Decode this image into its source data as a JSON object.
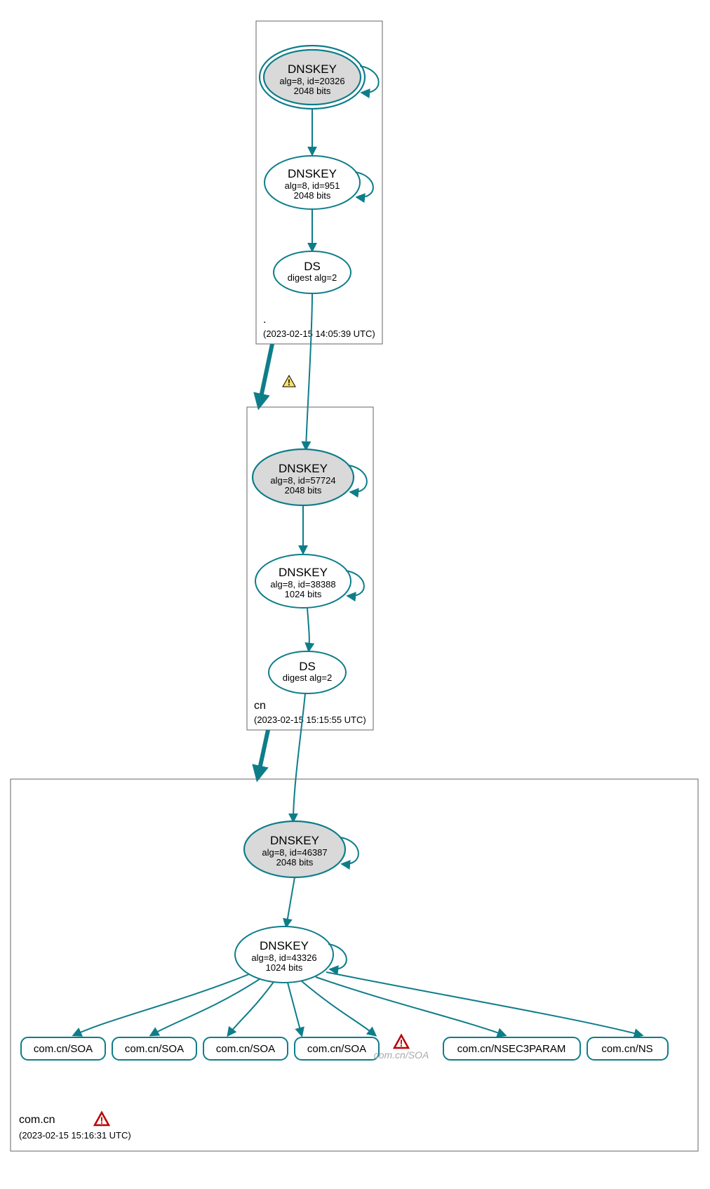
{
  "colors": {
    "stroke": "#0e7d8a",
    "ksk_fill": "#d9d9d9",
    "warn_fill": "#ffe066",
    "error_stroke": "#b00"
  },
  "zones": [
    {
      "id": "root",
      "label": ".",
      "timestamp": "(2023-02-15 14:05:39 UTC)",
      "nodes": [
        {
          "id": "root-ksk",
          "type": "dnskey-ksk-trust",
          "title": "DNSKEY",
          "sub1": "alg=8, id=20326",
          "sub2": "2048 bits"
        },
        {
          "id": "root-zsk",
          "type": "dnskey-zsk",
          "title": "DNSKEY",
          "sub1": "alg=8, id=951",
          "sub2": "2048 bits"
        },
        {
          "id": "root-ds",
          "type": "ds",
          "title": "DS",
          "sub1": "digest alg=2"
        }
      ]
    },
    {
      "id": "cn",
      "label": "cn",
      "timestamp": "(2023-02-15 15:15:55 UTC)",
      "nodes": [
        {
          "id": "cn-ksk",
          "type": "dnskey-ksk",
          "title": "DNSKEY",
          "sub1": "alg=8, id=57724",
          "sub2": "2048 bits"
        },
        {
          "id": "cn-zsk",
          "type": "dnskey-zsk",
          "title": "DNSKEY",
          "sub1": "alg=8, id=38388",
          "sub2": "1024 bits"
        },
        {
          "id": "cn-ds",
          "type": "ds",
          "title": "DS",
          "sub1": "digest alg=2"
        }
      ]
    },
    {
      "id": "comcn",
      "label": "com.cn",
      "timestamp": "(2023-02-15 15:16:31 UTC)",
      "status": "error",
      "nodes": [
        {
          "id": "comcn-ksk",
          "type": "dnskey-ksk",
          "title": "DNSKEY",
          "sub1": "alg=8, id=46387",
          "sub2": "2048 bits"
        },
        {
          "id": "comcn-zsk",
          "type": "dnskey-zsk",
          "title": "DNSKEY",
          "sub1": "alg=8, id=43326",
          "sub2": "1024 bits"
        },
        {
          "id": "rr1",
          "type": "record",
          "label": "com.cn/SOA"
        },
        {
          "id": "rr2",
          "type": "record",
          "label": "com.cn/SOA"
        },
        {
          "id": "rr3",
          "type": "record",
          "label": "com.cn/SOA"
        },
        {
          "id": "rr4",
          "type": "record",
          "label": "com.cn/SOA"
        },
        {
          "id": "rr5",
          "type": "record-faded",
          "label": "com.cn/SOA",
          "status": "error"
        },
        {
          "id": "rr6",
          "type": "record",
          "label": "com.cn/NSEC3PARAM"
        },
        {
          "id": "rr7",
          "type": "record",
          "label": "com.cn/NS"
        }
      ]
    }
  ],
  "edges": [
    {
      "from": "root-ksk",
      "to": "root-ksk",
      "kind": "self"
    },
    {
      "from": "root-ksk",
      "to": "root-zsk"
    },
    {
      "from": "root-zsk",
      "to": "root-zsk",
      "kind": "self"
    },
    {
      "from": "root-zsk",
      "to": "root-ds"
    },
    {
      "from": "root-ds",
      "to": "cn-ksk"
    },
    {
      "from": "root",
      "to": "cn",
      "kind": "zone",
      "status": "warning"
    },
    {
      "from": "cn-ksk",
      "to": "cn-ksk",
      "kind": "self"
    },
    {
      "from": "cn-ksk",
      "to": "cn-zsk"
    },
    {
      "from": "cn-zsk",
      "to": "cn-zsk",
      "kind": "self"
    },
    {
      "from": "cn-zsk",
      "to": "cn-ds"
    },
    {
      "from": "cn-ds",
      "to": "comcn-ksk"
    },
    {
      "from": "cn",
      "to": "comcn",
      "kind": "zone"
    },
    {
      "from": "comcn-ksk",
      "to": "comcn-ksk",
      "kind": "self"
    },
    {
      "from": "comcn-ksk",
      "to": "comcn-zsk"
    },
    {
      "from": "comcn-zsk",
      "to": "comcn-zsk",
      "kind": "self"
    },
    {
      "from": "comcn-zsk",
      "to": "rr1"
    },
    {
      "from": "comcn-zsk",
      "to": "rr2"
    },
    {
      "from": "comcn-zsk",
      "to": "rr3"
    },
    {
      "from": "comcn-zsk",
      "to": "rr4"
    },
    {
      "from": "comcn-zsk",
      "to": "rr5"
    },
    {
      "from": "comcn-zsk",
      "to": "rr6"
    },
    {
      "from": "comcn-zsk",
      "to": "rr7"
    }
  ]
}
